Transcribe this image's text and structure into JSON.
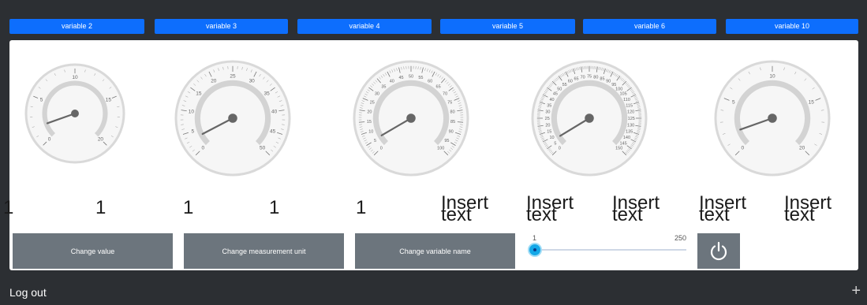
{
  "tabs": [
    "variable 2",
    "variable 3",
    "variable 4",
    "variable 5",
    "variable 6",
    "variable 10"
  ],
  "gauges": [
    {
      "name": "gauge-variable-2",
      "min": 0,
      "max": 20,
      "value": 1,
      "labels": [
        "0",
        "5",
        "10",
        "15",
        "20"
      ]
    },
    {
      "name": "gauge-variable-3",
      "min": 0,
      "max": 50,
      "value": 1,
      "labels": [
        "0",
        "5",
        "10",
        "15",
        "20",
        "25",
        "30",
        "35",
        "40",
        "45",
        "50"
      ]
    },
    {
      "name": "gauge-variable-4",
      "min": 0,
      "max": 100,
      "value": 1,
      "labels": [
        "0",
        "5",
        "10",
        "15",
        "20",
        "25",
        "30",
        "35",
        "40",
        "45",
        "50",
        "55",
        "60",
        "65",
        "70",
        "75",
        "80",
        "85",
        "90",
        "95",
        "100"
      ]
    },
    {
      "name": "gauge-variable-5",
      "min": 0,
      "max": 150,
      "value": 1,
      "labels": [
        "0",
        "5",
        "10",
        "15",
        "20",
        "25",
        "30",
        "35",
        "40",
        "45",
        "50",
        "55",
        "60",
        "65",
        "70",
        "75",
        "80",
        "85",
        "90",
        "95",
        "100",
        "105",
        "110",
        "115",
        "120",
        "125",
        "130",
        "135",
        "140",
        "145",
        "150"
      ]
    },
    {
      "name": "gauge-variable-10",
      "min": 0,
      "max": 20,
      "value": 1,
      "labels": [
        "0",
        "5",
        "10",
        "15",
        "20"
      ]
    }
  ],
  "values": [
    "1",
    "1",
    "1",
    "1",
    "1"
  ],
  "insert_texts": [
    "Insert text",
    "Insert text",
    "Insert text",
    "Insert text",
    "Insert text"
  ],
  "buttons": {
    "change_value": "Change value",
    "change_unit": "Change measurement unit",
    "change_name": "Change variable name"
  },
  "slider": {
    "min_label": "1",
    "max_label": "250",
    "min": 1,
    "max": 250,
    "value": 1
  },
  "footer": {
    "logout": "Log out",
    "plus": "+"
  },
  "colors": {
    "tab_bg": "#0d6efd",
    "button_bg": "#6c757d",
    "slider_thumb": "#13a8e8",
    "gauge_track": "#d3d3d3",
    "needle": "#666666"
  },
  "icons": {
    "power": "power-icon",
    "plus": "plus-icon"
  }
}
